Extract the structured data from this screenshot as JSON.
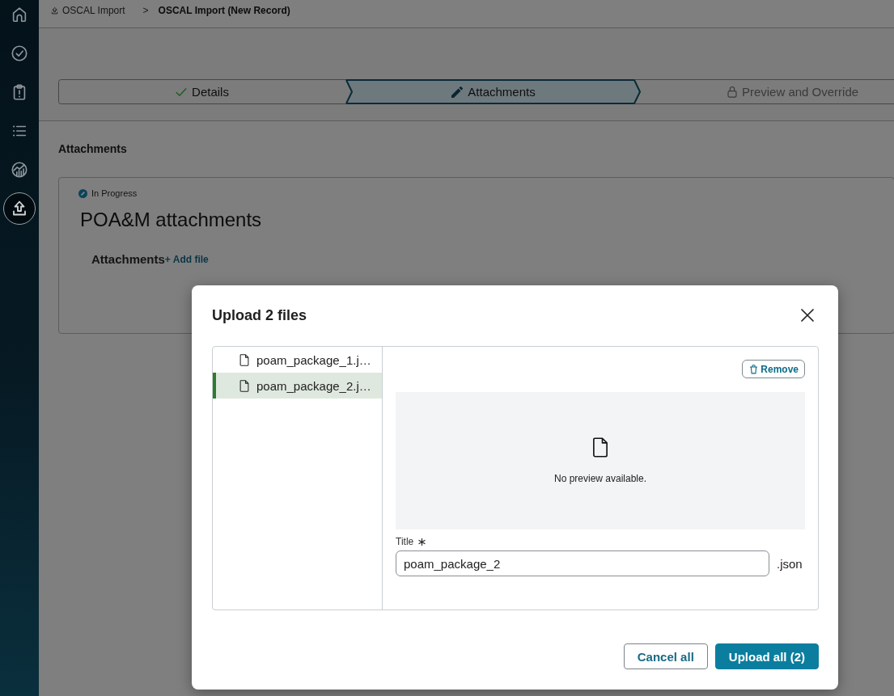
{
  "sidebar": {
    "items": [
      {
        "kind": "home",
        "selected": false
      },
      {
        "kind": "check",
        "selected": false
      },
      {
        "kind": "clipboard",
        "selected": false
      },
      {
        "kind": "list",
        "selected": false
      },
      {
        "kind": "chart",
        "selected": false
      },
      {
        "kind": "upload",
        "selected": true
      }
    ]
  },
  "breadcrumb": {
    "items": [
      {
        "label": "OSCAL Import",
        "current": false
      },
      {
        "label": "OSCAL Import (New Record)",
        "current": true
      }
    ],
    "separator": ">"
  },
  "stepper": {
    "steps": [
      {
        "label": "Details",
        "kind": "done",
        "selected": false,
        "disabled": false
      },
      {
        "label": "Attachments",
        "kind": "editing",
        "selected": true,
        "disabled": false
      },
      {
        "label": "Preview and Override",
        "kind": "locked",
        "selected": false,
        "disabled": true
      }
    ]
  },
  "section": {
    "heading": "Attachments",
    "card": {
      "status": "In Progress",
      "title": "POA&M attachments",
      "field_label": "Attachments",
      "add_link": "+ Add file"
    }
  },
  "dialog": {
    "title": "Upload 2 files",
    "files": [
      {
        "name": "poam_package_1.j…",
        "selected": false
      },
      {
        "name": "poam_package_2.j…",
        "selected": true
      }
    ],
    "remove_button": "Remove",
    "preview_message": "No preview available.",
    "title_field": {
      "label": "Title",
      "required": true,
      "value": "poam_package_2",
      "suffix": ".json"
    },
    "buttons": [
      {
        "label": "Cancel all",
        "kind": "secondary"
      },
      {
        "label": "Upload all (2)",
        "kind": "primary"
      }
    ]
  }
}
